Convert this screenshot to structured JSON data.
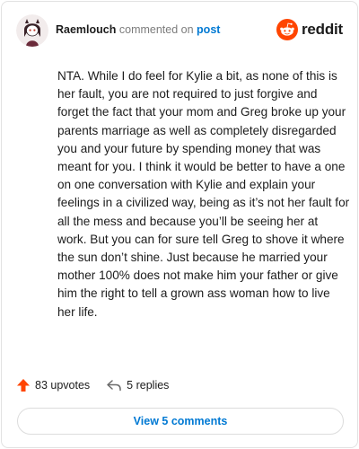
{
  "header": {
    "username": "Raemlouch",
    "verb": "commented on",
    "link_text": "post",
    "brand_name": "reddit",
    "avatar_icon": "user-avatar",
    "brand_icon": "reddit-snoo-icon"
  },
  "comment": {
    "body": "NTA. While I do feel for Kylie a bit, as none of this is her fault, you are not required to just forgive and forget the fact that your mom and Greg broke up your parents marriage as well as completely disregarded you and your future by spending money that was meant for you. I think it would be better to have a one on one conversation with Kylie and explain your feelings in a civilized way, being as it’s not her fault for all the mess and because you’ll be seeing her at work. But you can for sure tell Greg to shove it where the sun don’t shine. Just because he married your mother 100% does not make him your father or give him the right to tell a grown ass woman how to live her life."
  },
  "actions": {
    "upvotes_label": "83 upvotes",
    "replies_label": "5 replies",
    "upvote_icon": "upvote-arrow-icon",
    "reply_icon": "reply-arrow-icon"
  },
  "footer": {
    "view_comments_label": "View 5 comments"
  },
  "colors": {
    "link_blue": "#0079d3",
    "reddit_orange": "#ff4500",
    "muted_text": "#7c7c7c"
  }
}
